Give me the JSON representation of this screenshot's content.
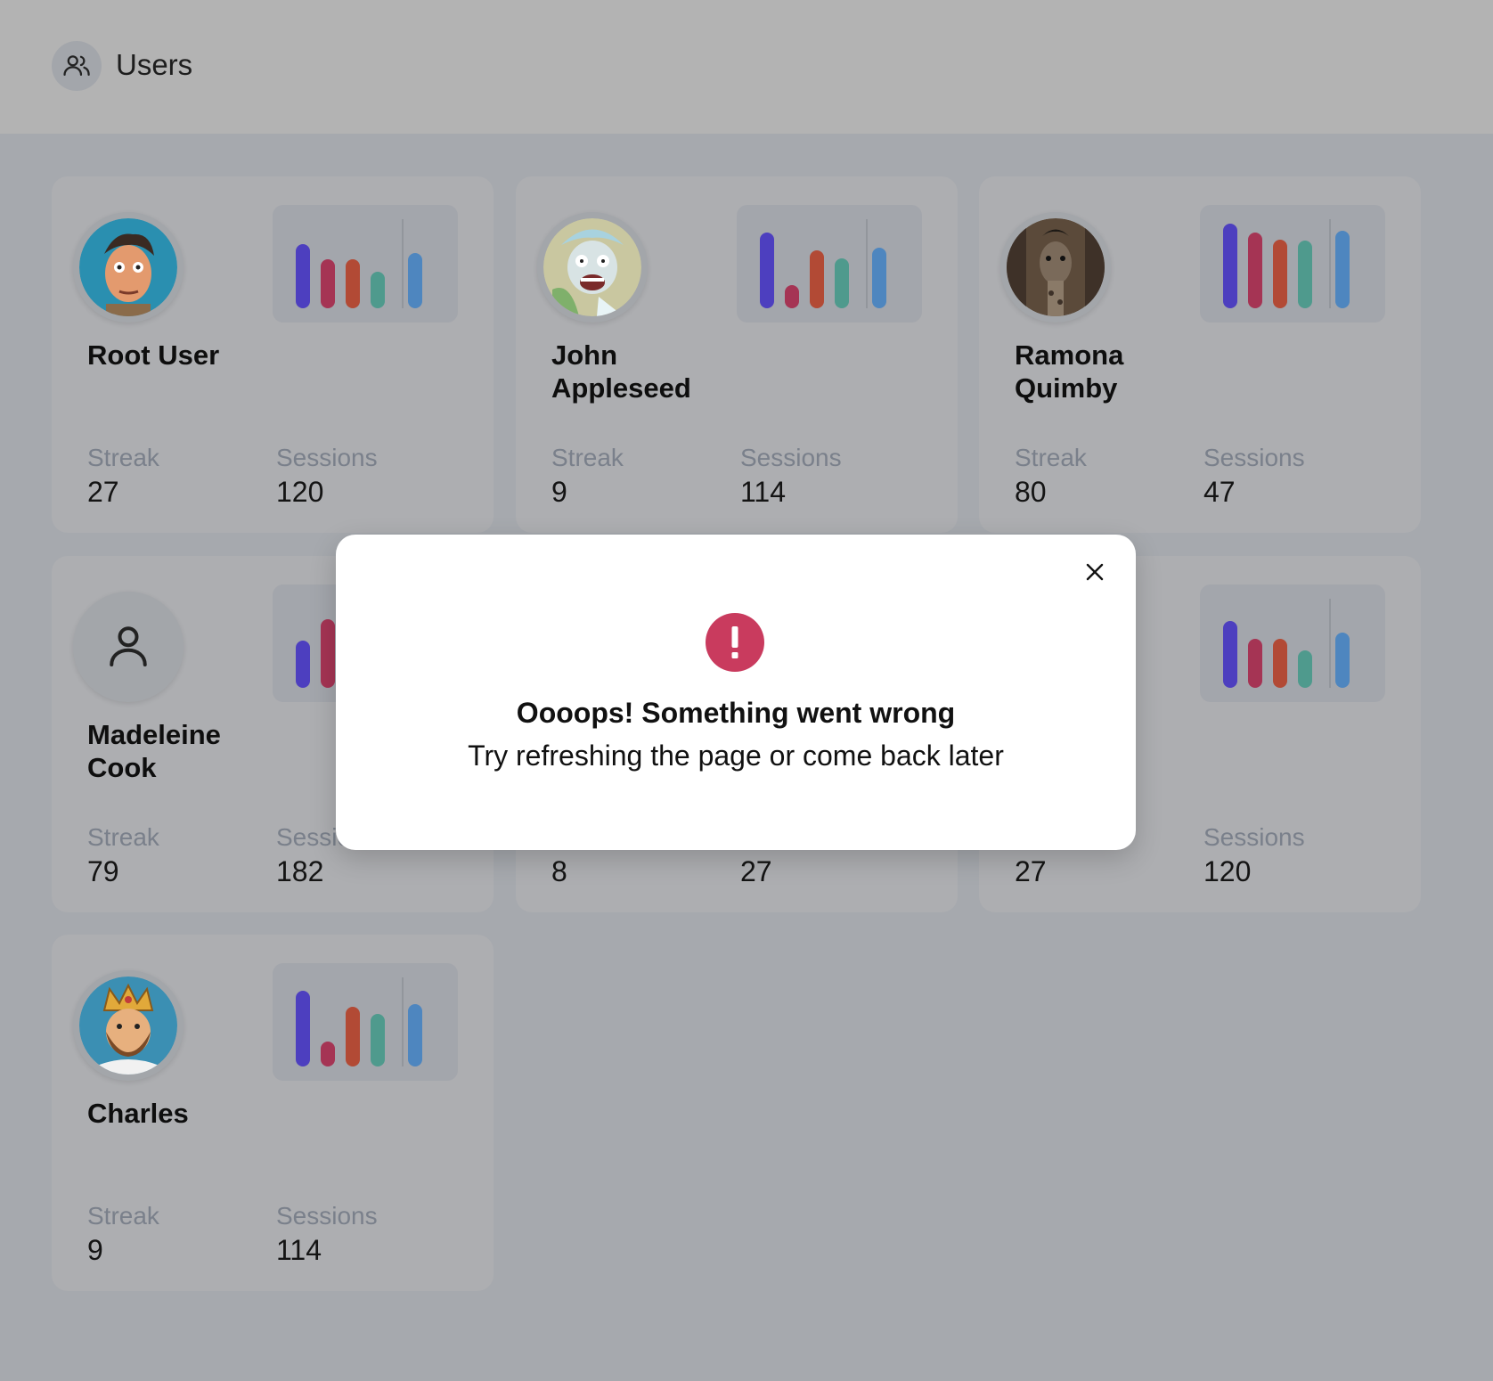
{
  "header": {
    "title": "Users",
    "icon": "users-icon"
  },
  "labels": {
    "streak": "Streak",
    "sessions": "Sessions"
  },
  "colors": {
    "bars": [
      "#4d3fbf",
      "#a53454",
      "#b24a35",
      "#4f9a8d",
      "#4e86bf"
    ],
    "alert": "#c93b5e"
  },
  "users": [
    {
      "name": "Root User",
      "streak": "27",
      "sessions": "120",
      "avatar": "cartoon-man-avatar",
      "chart_data": {
        "type": "bar",
        "values": [
          0.72,
          0.55,
          0.55,
          0.41,
          0.62
        ]
      }
    },
    {
      "name": "John Appleseed",
      "streak": "9",
      "sessions": "114",
      "avatar": "cartoon-scientist-avatar",
      "chart_data": {
        "type": "bar",
        "values": [
          0.85,
          0.26,
          0.65,
          0.56,
          0.68
        ]
      }
    },
    {
      "name": "Ramona Quimby",
      "streak": "80",
      "sessions": "47",
      "avatar": "giraffe-photo-avatar",
      "chart_data": {
        "type": "bar",
        "values": [
          0.95,
          0.85,
          0.77,
          0.76,
          0.87
        ]
      }
    },
    {
      "name": "Madeleine Cook",
      "streak": "79",
      "sessions": "182",
      "avatar": "person-placeholder-icon",
      "chart_data": {
        "type": "bar",
        "values": [
          0.53,
          0.77,
          null,
          null,
          null
        ]
      }
    },
    {
      "name": "",
      "streak": "8",
      "sessions": "27",
      "avatar": "",
      "chart_data": {
        "type": "bar",
        "values": []
      }
    },
    {
      "name": "",
      "streak": "27",
      "sessions": "120",
      "avatar": "",
      "chart_data": {
        "type": "bar",
        "values": [
          0.75,
          0.55,
          0.55,
          0.42,
          0.62
        ]
      }
    },
    {
      "name": "Charles",
      "streak": "9",
      "sessions": "114",
      "avatar": "cartoon-king-avatar",
      "chart_data": {
        "type": "bar",
        "values": [
          0.85,
          0.28,
          0.67,
          0.59,
          0.7
        ]
      }
    }
  ],
  "modal": {
    "heading": "Oooops! Something went wrong",
    "message": "Try refreshing the page or come back later"
  }
}
